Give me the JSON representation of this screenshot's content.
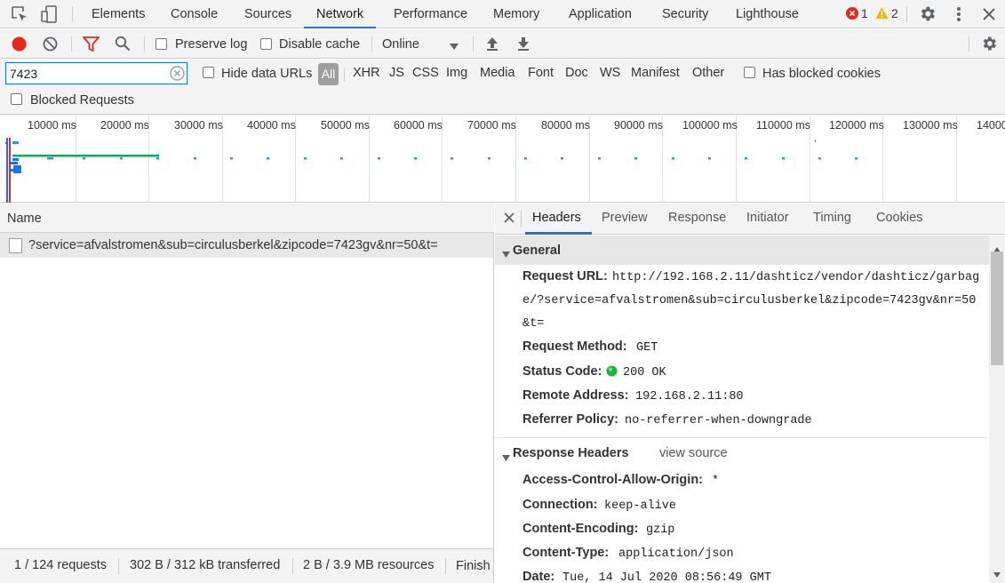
{
  "top_tabs": [
    "Elements",
    "Console",
    "Sources",
    "Network",
    "Performance",
    "Memory",
    "Application",
    "Security",
    "Lighthouse"
  ],
  "active_tab": "Network",
  "error_count": "1",
  "warning_count": "2",
  "toolbar": {
    "preserve_log": "Preserve log",
    "disable_cache": "Disable cache",
    "throttling": "Online"
  },
  "filter": {
    "value": "7423",
    "hide_data_urls": "Hide data URLs",
    "types": [
      "All",
      "XHR",
      "JS",
      "CSS",
      "Img",
      "Media",
      "Font",
      "Doc",
      "WS",
      "Manifest",
      "Other"
    ],
    "has_blocked_cookies": "Has blocked cookies",
    "blocked_requests": "Blocked Requests"
  },
  "timeline": {
    "ticks": [
      "10000 ms",
      "20000 ms",
      "30000 ms",
      "40000 ms",
      "50000 ms",
      "60000 ms",
      "70000 ms",
      "80000 ms",
      "90000 ms",
      "100000 ms",
      "110000 ms",
      "120000 ms",
      "130000 ms",
      "14000"
    ]
  },
  "request_list": {
    "column_name": "Name",
    "rows": [
      "?service=afvalstromen&sub=circulusberkel&zipcode=7423gv&nr=50&t="
    ]
  },
  "status_bar": {
    "requests": "1 / 124 requests",
    "transferred": "302 B / 312 kB transferred",
    "resources": "2 B / 3.9 MB resources",
    "finish": "Finish"
  },
  "details": {
    "tabs": [
      "Headers",
      "Preview",
      "Response",
      "Initiator",
      "Timing",
      "Cookies"
    ],
    "active_tab": "Headers",
    "general": {
      "title": "General",
      "request_url_label": "Request URL:",
      "request_url_lines": [
        "http://192.168.2.11/dashticz/vendor/dashticz/garbag",
        "e/?service=afvalstromen&sub=circulusberkel&zipcode=7423gv&nr=50",
        "&t="
      ],
      "request_method_label": "Request Method:",
      "request_method": "GET",
      "status_code_label": "Status Code:",
      "status_code": "200 OK",
      "remote_address_label": "Remote Address:",
      "remote_address": "192.168.2.11:80",
      "referrer_policy_label": "Referrer Policy:",
      "referrer_policy": "no-referrer-when-downgrade"
    },
    "response_headers": {
      "title": "Response Headers",
      "view_source": "view source",
      "items": [
        {
          "key": "Access-Control-Allow-Origin:",
          "value": "*"
        },
        {
          "key": "Connection:",
          "value": "keep-alive"
        },
        {
          "key": "Content-Encoding:",
          "value": "gzip"
        },
        {
          "key": "Content-Type:",
          "value": "application/json"
        },
        {
          "key": "Date:",
          "value": "Tue, 14 Jul 2020 08:56:49 GMT"
        }
      ]
    }
  },
  "colors": {
    "accent": "#1a73e8",
    "record": "#e8271c",
    "filter_icon": "#d93025",
    "status_ok": "#1db33a",
    "timeline_green": "#1aa260",
    "timeline_blue": "#1a73e8"
  }
}
